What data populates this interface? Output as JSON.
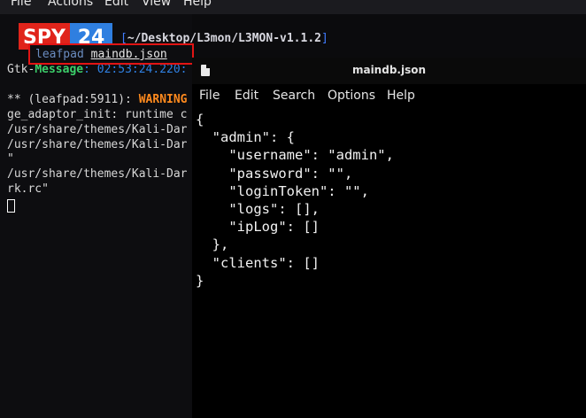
{
  "menubar": {
    "items": [
      "File",
      "Actions",
      "Edit",
      "View",
      "Help"
    ]
  },
  "logo": {
    "text_a": "SPY",
    "text_b": "24"
  },
  "terminal": {
    "prompt_path": "~/Desktop/L3mon/L3MON-v1.1.2",
    "prompt_close": "]",
    "prompt_open": "[",
    "command_program": "leafpad",
    "command_file": "maindb.json",
    "line_gtk_a": "Gtk-",
    "line_gtk_b": "Message",
    "line_gtk_c": ": 02:53:24.220:",
    "line_warn_a": "** (leafpad:5911): ",
    "line_warn_b": "WARNING",
    "line_warn_c": " **",
    "line_3": "ge_adaptor_init: runtime c",
    "line_4": "/usr/share/themes/Kali-Dar",
    "line_5": "/usr/share/themes/Kali-Dar",
    "line_6": "\"",
    "line_7": "/usr/share/themes/Kali-Dar",
    "line_8": "rk.rc\""
  },
  "leafpad": {
    "title": "maindb.json",
    "menu": [
      "File",
      "Edit",
      "Search",
      "Options",
      "Help"
    ],
    "content": "{\n  \"admin\": {\n    \"username\": \"admin\",\n    \"password\": \"\",\n    \"loginToken\": \"\",\n    \"logs\": [],\n    \"ipLog\": []\n  },\n  \"clients\": []\n}"
  },
  "colors": {
    "highlight_box": "#e21414",
    "logo_red": "#e0241b",
    "logo_blue": "#2f7fe0",
    "warning": "#ff8a1e",
    "message": "#3ccf6a"
  }
}
